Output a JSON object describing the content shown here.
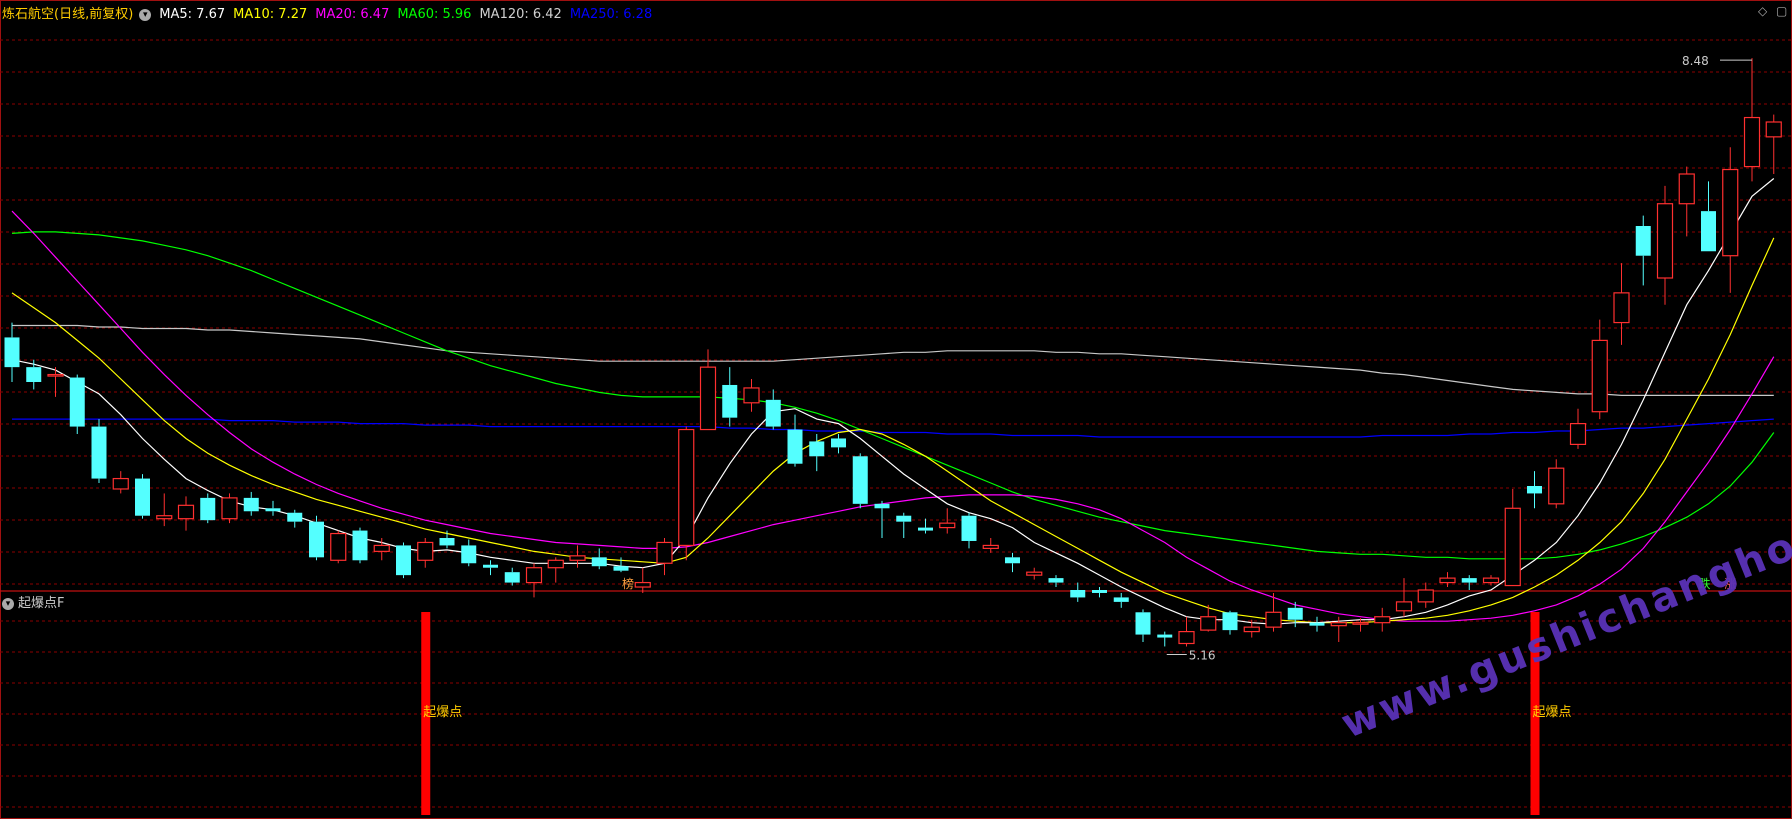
{
  "header": {
    "title": "炼石航空(日线,前复权)",
    "mas": [
      {
        "label": "MA5: 7.67",
        "color": "#ffffff"
      },
      {
        "label": "MA10: 7.27",
        "color": "#ffff00"
      },
      {
        "label": "MA20: 6.47",
        "color": "#ff00ff"
      },
      {
        "label": "MA60: 5.96",
        "color": "#00ff00"
      },
      {
        "label": "MA120: 6.42",
        "color": "#d0d0d0"
      },
      {
        "label": "MA250: 6.28",
        "color": "#0000ff"
      }
    ]
  },
  "sub_panel": {
    "title": "起爆点F"
  },
  "annotations": {
    "high_label": "8.48",
    "low_label": "5.16",
    "marker_bang": "榜",
    "marker_die": "跌",
    "marker_zhang": "涨",
    "signal_label": "起爆点"
  },
  "watermark": "www.gushichanghong.com",
  "colors": {
    "up": "#ff3030",
    "down": "#54ffff",
    "signal": "#ff0000",
    "grid": "#8b0000",
    "ma5": "#ffffff",
    "ma10": "#ffff00",
    "ma20": "#ff00ff",
    "ma60": "#00ff00",
    "ma120": "#c8c8c8",
    "ma250": "#0000ff"
  },
  "chart_data": {
    "type": "candlestick",
    "price_range": [
      4.9,
      8.75
    ],
    "candles": [
      [
        6.6,
        6.4,
        6.7,
        6.3
      ],
      [
        6.4,
        6.3,
        6.45,
        6.25
      ],
      [
        6.35,
        6.35,
        6.4,
        6.2
      ],
      [
        6.33,
        6.0,
        6.35,
        5.95
      ],
      [
        6.0,
        5.65,
        6.05,
        5.62
      ],
      [
        5.58,
        5.65,
        5.7,
        5.55
      ],
      [
        5.65,
        5.4,
        5.68,
        5.38
      ],
      [
        5.38,
        5.4,
        5.55,
        5.33
      ],
      [
        5.38,
        5.47,
        5.53,
        5.3
      ],
      [
        5.52,
        5.37,
        5.55,
        5.35
      ],
      [
        5.38,
        5.52,
        5.55,
        5.35
      ],
      [
        5.52,
        5.43,
        5.56,
        5.4
      ],
      [
        5.45,
        5.43,
        5.5,
        5.4
      ],
      [
        5.42,
        5.36,
        5.44,
        5.32
      ],
      [
        5.36,
        5.12,
        5.4,
        5.1
      ],
      [
        5.1,
        5.28,
        5.3,
        5.08
      ],
      [
        5.3,
        5.1,
        5.32,
        5.08
      ],
      [
        5.16,
        5.2,
        5.25,
        5.1
      ],
      [
        5.2,
        5.0,
        5.22,
        4.98
      ],
      [
        5.1,
        5.22,
        5.25,
        5.05
      ],
      [
        5.25,
        5.2,
        5.3,
        5.18
      ],
      [
        5.2,
        5.08,
        5.24,
        5.06
      ],
      [
        5.07,
        5.05,
        5.1,
        5.0
      ],
      [
        5.02,
        4.95,
        5.05,
        4.93
      ],
      [
        4.95,
        5.05,
        5.08,
        4.85
      ],
      [
        5.05,
        5.1,
        5.12,
        4.95
      ],
      [
        5.1,
        5.13,
        5.2,
        5.05
      ],
      [
        5.12,
        5.06,
        5.18,
        5.04
      ],
      [
        5.06,
        5.03,
        5.12,
        5.02
      ],
      [
        4.92,
        4.95,
        5.05,
        4.88
      ],
      [
        5.08,
        5.22,
        5.25,
        5.0
      ],
      [
        5.2,
        5.98,
        6.0,
        5.1
      ],
      [
        5.98,
        6.4,
        6.52,
        5.98
      ],
      [
        6.28,
        6.06,
        6.4,
        6.0
      ],
      [
        6.16,
        6.26,
        6.32,
        6.1
      ],
      [
        6.18,
        6.0,
        6.25,
        5.98
      ],
      [
        5.98,
        5.75,
        6.08,
        5.73
      ],
      [
        5.9,
        5.8,
        5.95,
        5.7
      ],
      [
        5.92,
        5.86,
        5.95,
        5.82
      ],
      [
        5.8,
        5.48,
        5.82,
        5.45
      ],
      [
        5.48,
        5.45,
        5.5,
        5.25
      ],
      [
        5.4,
        5.36,
        5.42,
        5.25
      ],
      [
        5.32,
        5.3,
        5.38,
        5.28
      ],
      [
        5.32,
        5.35,
        5.45,
        5.28
      ],
      [
        5.4,
        5.23,
        5.42,
        5.18
      ],
      [
        5.18,
        5.2,
        5.25,
        5.15
      ],
      [
        5.12,
        5.08,
        5.15,
        5.02
      ],
      [
        5.0,
        5.02,
        5.05,
        4.97
      ],
      [
        4.98,
        4.95,
        5.0,
        4.92
      ],
      [
        4.9,
        4.85,
        4.95,
        4.82
      ],
      [
        4.9,
        4.88,
        4.92,
        4.85
      ],
      [
        4.85,
        4.82,
        4.88,
        4.78
      ],
      [
        4.75,
        4.6,
        4.77,
        4.55
      ],
      [
        4.6,
        4.58,
        4.62,
        4.52
      ],
      [
        4.54,
        4.62,
        4.72,
        4.52
      ],
      [
        4.63,
        4.72,
        4.8,
        4.62
      ],
      [
        4.75,
        4.63,
        4.76,
        4.6
      ],
      [
        4.62,
        4.65,
        4.7,
        4.58
      ],
      [
        4.65,
        4.75,
        4.88,
        4.62
      ],
      [
        4.78,
        4.7,
        4.82,
        4.65
      ],
      [
        4.68,
        4.66,
        4.72,
        4.62
      ],
      [
        4.66,
        4.68,
        4.72,
        4.55
      ],
      [
        4.68,
        4.68,
        4.71,
        4.62
      ],
      [
        4.68,
        4.72,
        4.78,
        4.62
      ],
      [
        4.76,
        4.82,
        4.98,
        4.72
      ],
      [
        4.82,
        4.9,
        4.95,
        4.78
      ],
      [
        4.95,
        4.98,
        5.02,
        4.92
      ],
      [
        4.98,
        4.95,
        5.0,
        4.9
      ],
      [
        4.95,
        4.98,
        5.0,
        4.93
      ],
      [
        4.93,
        5.45,
        5.58,
        4.93
      ],
      [
        5.6,
        5.55,
        5.7,
        5.45
      ],
      [
        5.48,
        5.72,
        5.78,
        5.45
      ],
      [
        5.88,
        6.02,
        6.12,
        5.85
      ],
      [
        6.1,
        6.58,
        6.72,
        6.05
      ],
      [
        6.7,
        6.9,
        7.1,
        6.55
      ],
      [
        7.35,
        7.15,
        7.42,
        6.95
      ],
      [
        7.0,
        7.5,
        7.62,
        6.82
      ],
      [
        7.5,
        7.7,
        7.75,
        7.28
      ],
      [
        7.45,
        7.18,
        7.65,
        7.18
      ],
      [
        7.15,
        7.73,
        7.88,
        6.9
      ],
      [
        7.75,
        8.08,
        8.48,
        7.65
      ],
      [
        7.95,
        8.05,
        8.1,
        7.7
      ]
    ],
    "ma5": [
      6.45,
      6.42,
      6.38,
      6.3,
      6.22,
      6.08,
      5.92,
      5.78,
      5.65,
      5.57,
      5.5,
      5.46,
      5.44,
      5.4,
      5.35,
      5.3,
      5.25,
      5.22,
      5.18,
      5.16,
      5.17,
      5.15,
      5.12,
      5.1,
      5.08,
      5.08,
      5.08,
      5.08,
      5.06,
      5.05,
      5.08,
      5.25,
      5.52,
      5.75,
      5.95,
      6.1,
      6.12,
      6.05,
      6.02,
      5.92,
      5.8,
      5.68,
      5.58,
      5.48,
      5.42,
      5.38,
      5.32,
      5.22,
      5.15,
      5.08,
      5.0,
      4.92,
      4.85,
      4.78,
      4.72,
      4.7,
      4.7,
      4.68,
      4.67,
      4.68,
      4.68,
      4.69,
      4.7,
      4.7,
      4.72,
      4.75,
      4.8,
      4.86,
      4.9,
      5.0,
      5.1,
      5.22,
      5.4,
      5.62,
      5.88,
      6.18,
      6.5,
      6.82,
      7.05,
      7.3,
      7.55,
      7.67
    ],
    "ma10": [
      6.9,
      6.8,
      6.7,
      6.58,
      6.46,
      6.32,
      6.18,
      6.04,
      5.92,
      5.82,
      5.74,
      5.67,
      5.61,
      5.56,
      5.51,
      5.47,
      5.43,
      5.39,
      5.35,
      5.31,
      5.28,
      5.25,
      5.22,
      5.19,
      5.16,
      5.14,
      5.12,
      5.11,
      5.1,
      5.09,
      5.08,
      5.12,
      5.25,
      5.4,
      5.55,
      5.7,
      5.82,
      5.9,
      5.96,
      5.98,
      5.95,
      5.88,
      5.8,
      5.7,
      5.6,
      5.5,
      5.42,
      5.34,
      5.26,
      5.18,
      5.1,
      5.02,
      4.95,
      4.88,
      4.83,
      4.78,
      4.74,
      4.72,
      4.7,
      4.69,
      4.68,
      4.68,
      4.68,
      4.69,
      4.7,
      4.71,
      4.73,
      4.76,
      4.8,
      4.85,
      4.92,
      5.0,
      5.1,
      5.22,
      5.36,
      5.55,
      5.78,
      6.05,
      6.32,
      6.62,
      6.95,
      7.27
    ],
    "ma20": [
      7.45,
      7.3,
      7.14,
      6.98,
      6.82,
      6.66,
      6.5,
      6.35,
      6.21,
      6.08,
      5.96,
      5.85,
      5.76,
      5.68,
      5.61,
      5.55,
      5.5,
      5.45,
      5.41,
      5.37,
      5.34,
      5.31,
      5.28,
      5.26,
      5.24,
      5.22,
      5.21,
      5.2,
      5.19,
      5.18,
      5.18,
      5.19,
      5.22,
      5.26,
      5.3,
      5.34,
      5.37,
      5.4,
      5.43,
      5.46,
      5.48,
      5.5,
      5.52,
      5.53,
      5.54,
      5.54,
      5.54,
      5.53,
      5.51,
      5.48,
      5.44,
      5.38,
      5.3,
      5.22,
      5.12,
      5.04,
      4.96,
      4.9,
      4.85,
      4.8,
      4.77,
      4.74,
      4.72,
      4.7,
      4.69,
      4.69,
      4.69,
      4.7,
      4.71,
      4.73,
      4.76,
      4.8,
      4.86,
      4.94,
      5.04,
      5.18,
      5.36,
      5.56,
      5.76,
      5.98,
      6.22,
      6.47
    ],
    "ma60": [
      7.3,
      7.31,
      7.31,
      7.3,
      7.29,
      7.27,
      7.25,
      7.22,
      7.19,
      7.15,
      7.1,
      7.05,
      6.99,
      6.93,
      6.87,
      6.81,
      6.75,
      6.69,
      6.63,
      6.57,
      6.51,
      6.46,
      6.41,
      6.37,
      6.33,
      6.29,
      6.26,
      6.23,
      6.21,
      6.2,
      6.2,
      6.2,
      6.2,
      6.19,
      6.18,
      6.16,
      6.13,
      6.09,
      6.04,
      5.98,
      5.92,
      5.86,
      5.8,
      5.74,
      5.68,
      5.62,
      5.56,
      5.51,
      5.47,
      5.43,
      5.39,
      5.36,
      5.33,
      5.3,
      5.28,
      5.26,
      5.24,
      5.22,
      5.2,
      5.18,
      5.16,
      5.15,
      5.14,
      5.14,
      5.13,
      5.12,
      5.12,
      5.11,
      5.11,
      5.11,
      5.11,
      5.12,
      5.14,
      5.17,
      5.21,
      5.26,
      5.32,
      5.39,
      5.48,
      5.6,
      5.76,
      5.96
    ],
    "ma120": [
      6.68,
      6.68,
      6.68,
      6.68,
      6.67,
      6.67,
      6.66,
      6.66,
      6.66,
      6.65,
      6.65,
      6.64,
      6.63,
      6.62,
      6.61,
      6.6,
      6.59,
      6.57,
      6.55,
      6.53,
      6.51,
      6.5,
      6.49,
      6.48,
      6.47,
      6.46,
      6.45,
      6.44,
      6.44,
      6.44,
      6.44,
      6.44,
      6.44,
      6.44,
      6.44,
      6.44,
      6.45,
      6.46,
      6.47,
      6.48,
      6.49,
      6.5,
      6.5,
      6.51,
      6.51,
      6.51,
      6.51,
      6.51,
      6.5,
      6.5,
      6.49,
      6.49,
      6.48,
      6.47,
      6.46,
      6.45,
      6.44,
      6.43,
      6.42,
      6.41,
      6.4,
      6.39,
      6.38,
      6.36,
      6.35,
      6.33,
      6.31,
      6.29,
      6.27,
      6.25,
      6.24,
      6.23,
      6.22,
      6.22,
      6.21,
      6.21,
      6.21,
      6.21,
      6.21,
      6.21,
      6.21,
      6.21
    ],
    "ma250": [
      6.05,
      6.05,
      6.05,
      6.05,
      6.05,
      6.05,
      6.05,
      6.05,
      6.05,
      6.05,
      6.04,
      6.04,
      6.04,
      6.03,
      6.03,
      6.03,
      6.02,
      6.02,
      6.02,
      6.01,
      6.01,
      6.01,
      6.0,
      6.0,
      6.0,
      6.0,
      6.0,
      6.0,
      6.0,
      6.0,
      6.0,
      6.0,
      6.0,
      5.99,
      5.99,
      5.98,
      5.98,
      5.97,
      5.97,
      5.97,
      5.96,
      5.96,
      5.96,
      5.95,
      5.95,
      5.95,
      5.94,
      5.94,
      5.94,
      5.94,
      5.93,
      5.93,
      5.93,
      5.93,
      5.93,
      5.93,
      5.93,
      5.93,
      5.93,
      5.93,
      5.93,
      5.93,
      5.93,
      5.94,
      5.94,
      5.94,
      5.94,
      5.95,
      5.95,
      5.96,
      5.96,
      5.97,
      5.97,
      5.98,
      5.99,
      5.99,
      6.0,
      6.01,
      6.02,
      6.03,
      6.04,
      6.05
    ],
    "signals": [
      19,
      70
    ]
  }
}
